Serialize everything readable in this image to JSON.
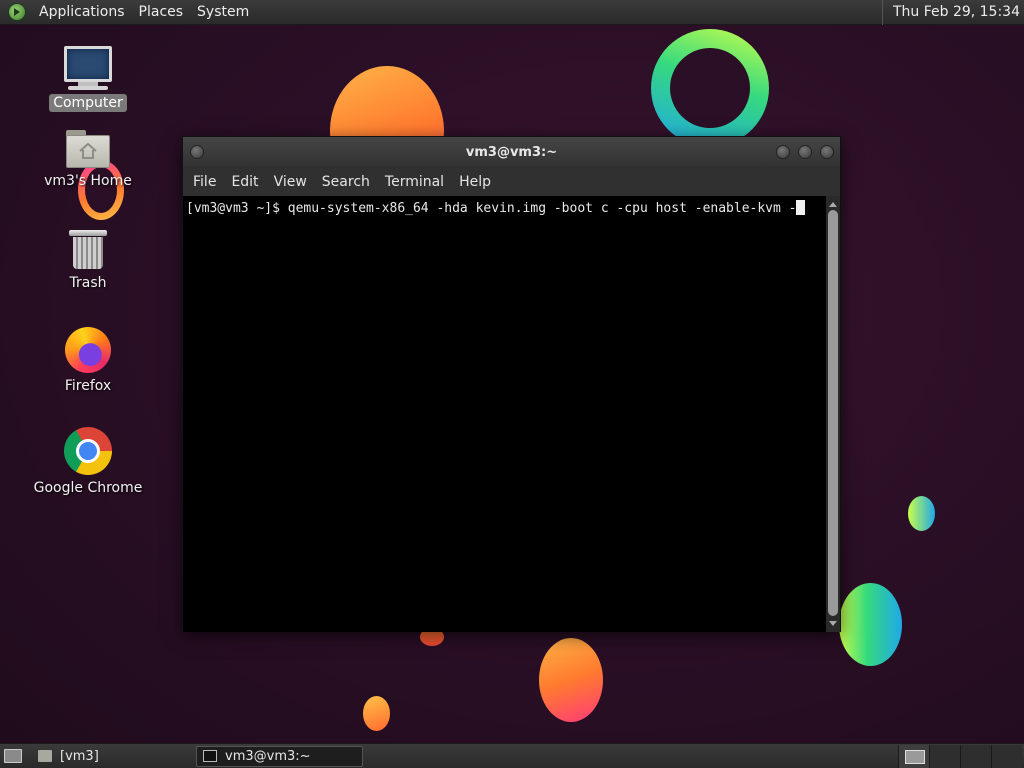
{
  "top_panel": {
    "menus": [
      "Applications",
      "Places",
      "System"
    ],
    "clock": "Thu Feb 29, 15:34"
  },
  "desktop_icons": [
    {
      "label": "Computer",
      "icon": "computer-icon",
      "selected": true
    },
    {
      "label": "vm3's Home",
      "icon": "home-folder-icon"
    },
    {
      "label": "Trash",
      "icon": "trash-icon"
    },
    {
      "label": "Firefox",
      "icon": "firefox-icon"
    },
    {
      "label": "Google Chrome",
      "icon": "chrome-icon"
    }
  ],
  "terminal": {
    "title": "vm3@vm3:~",
    "menu": [
      "File",
      "Edit",
      "View",
      "Search",
      "Terminal",
      "Help"
    ],
    "prompt": "[vm3@vm3 ~]$ ",
    "command": "qemu-system-x86_64 -hda kevin.img -boot c -cpu host -enable-kvm -"
  },
  "bottom_panel": {
    "tasks": [
      {
        "label": "[vm3]",
        "icon": "folder-icon",
        "active": false
      },
      {
        "label": "vm3@vm3:~",
        "icon": "terminal-icon",
        "active": true
      }
    ],
    "workspaces": 4,
    "current_workspace": 1
  },
  "colors": {
    "desktop_bg": "#2b0f26",
    "panel_bg": "#2f2f2f",
    "terminal_bg": "#000000"
  }
}
